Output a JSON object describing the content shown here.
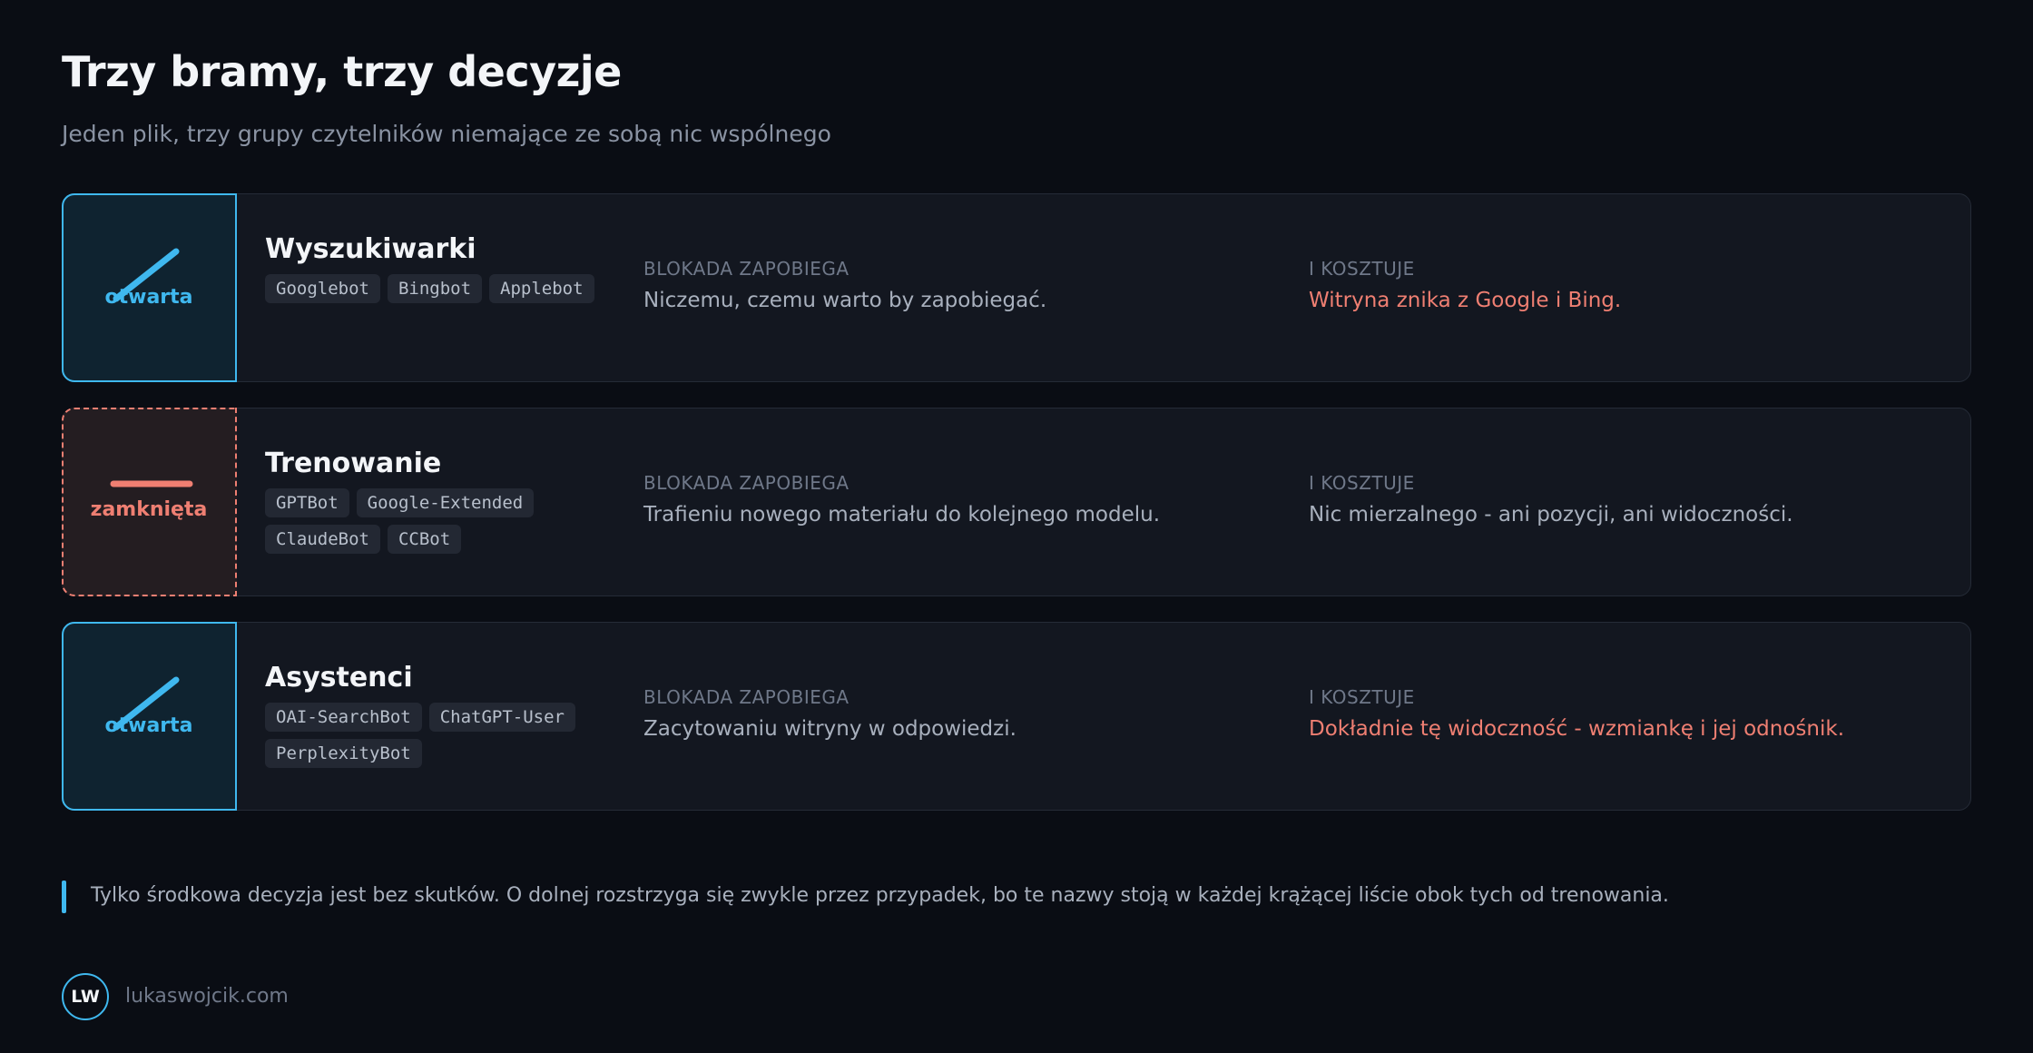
{
  "title": "Trzy bramy, trzy decyzje",
  "subtitle": "Jeden plik, trzy grupy czytelników niemające ze sobą nic wspólnego",
  "column_labels": {
    "prevents": "BLOKADA ZAPOBIEGA",
    "costs": "I KOSZTUJE"
  },
  "gates": [
    {
      "name": "Wyszukiwarki",
      "state": "otwarta",
      "icon": "open-gate-icon",
      "bots": [
        "Googlebot",
        "Bingbot",
        "Applebot"
      ],
      "prevents": "Niczemu, czemu warto by zapobiegać.",
      "costs": "Witryna znika z Google i Bing."
    },
    {
      "name": "Trenowanie",
      "state": "zamknięta",
      "icon": "closed-gate-icon",
      "bots": [
        "GPTBot",
        "Google-Extended",
        "ClaudeBot",
        "CCBot"
      ],
      "prevents": "Trafieniu nowego materiału do kolejnego modelu.",
      "costs": "Nic mierzalnego - ani pozycji, ani widoczności."
    },
    {
      "name": "Asystenci",
      "state": "otwarta",
      "icon": "open-gate-icon",
      "bots": [
        "OAI-SearchBot",
        "ChatGPT-User",
        "PerplexityBot"
      ],
      "prevents": "Zacytowaniu witryny w odpowiedzi.",
      "costs": "Dokładnie tę widoczność - wzmiankę i jej odnośnik."
    }
  ],
  "note": "Tylko środkowa decyzja jest bez skutków. O dolnej rozstrzyga się zwykle przez przypadek, bo te nazwy stoją w każdej krążącej liście obok tych od trenowania.",
  "footer": {
    "logo_text": "LW",
    "site": "lukaswojcik.com"
  },
  "colors": {
    "accent": "#3fb8ef",
    "warning": "#ef7f72",
    "background": "#0a0d14",
    "card": "#131720"
  }
}
